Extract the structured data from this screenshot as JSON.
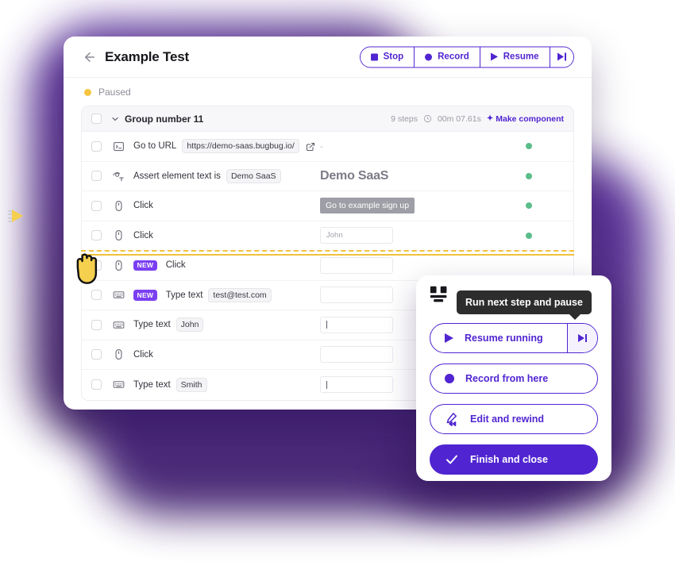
{
  "brand": {
    "purple": "#5025d1",
    "badge_purple": "#7b3ff2",
    "yellow": "#f0c23c",
    "green": "#5bbd8a",
    "tooltip_bg": "#2d2d2d"
  },
  "header": {
    "back_icon": "arrow-left-icon",
    "title": "Example Test"
  },
  "toolbar": {
    "stop_label": "Stop",
    "record_label": "Record",
    "resume_label": "Resume",
    "step_label": ""
  },
  "status": {
    "text": "Paused",
    "dot_color": "#f5c542"
  },
  "group": {
    "title": "Group number 11",
    "steps_count": "9 steps",
    "duration": "00m 07.61s",
    "make_component": "Make component",
    "spark": "✦"
  },
  "steps": [
    {
      "icon": "terminal-icon",
      "label": "Go to URL",
      "chip": "https://demo-saas.bugbug.io/",
      "external_link": true,
      "badge": "",
      "preview_type": "dash",
      "preview_text": "-",
      "status": "pass"
    },
    {
      "icon": "assert-text-icon",
      "label": "Assert element text is",
      "chip": "Demo SaaS",
      "external_link": false,
      "badge": "",
      "preview_type": "heading",
      "preview_text": "Demo SaaS",
      "status": "pass"
    },
    {
      "icon": "mouse-icon",
      "label": "Click",
      "chip": "",
      "external_link": false,
      "badge": "",
      "preview_type": "button",
      "preview_text": "Go to example sign up",
      "status": "pass"
    },
    {
      "icon": "mouse-icon",
      "label": "Click",
      "chip": "",
      "external_link": false,
      "badge": "",
      "preview_type": "input",
      "preview_text": "John",
      "status": "pass"
    },
    {
      "icon": "mouse-icon",
      "label": "Click",
      "chip": "",
      "external_link": false,
      "badge": "NEW",
      "preview_type": "input-empty",
      "preview_text": "",
      "status": "none"
    },
    {
      "icon": "keyboard-icon",
      "label": "Type text",
      "chip": "test@test.com",
      "external_link": false,
      "badge": "NEW",
      "preview_type": "input-empty",
      "preview_text": "",
      "status": "none"
    },
    {
      "icon": "keyboard-icon",
      "label": "Type text",
      "chip": "John",
      "external_link": false,
      "badge": "",
      "preview_type": "input-caret",
      "preview_text": "",
      "status": "none"
    },
    {
      "icon": "mouse-icon",
      "label": "Click",
      "chip": "",
      "external_link": false,
      "badge": "",
      "preview_type": "input-empty",
      "preview_text": "",
      "status": "none"
    },
    {
      "icon": "keyboard-icon",
      "label": "Type text",
      "chip": "Smith",
      "external_link": false,
      "badge": "",
      "preview_type": "input-caret",
      "preview_text": "",
      "status": "none"
    }
  ],
  "popup": {
    "logo_icon": "bugbug-logo-icon",
    "tooltip": "Run next step and pause",
    "buttons": [
      {
        "label": "Resume running",
        "icon": "play-icon",
        "has_step": true,
        "filled": false
      },
      {
        "label": "Record from here",
        "icon": "record-icon",
        "has_step": false,
        "filled": false
      },
      {
        "label": "Edit and rewind",
        "icon": "edit-rewind-icon",
        "has_step": false,
        "filled": false
      },
      {
        "label": "Finish and close",
        "icon": "check-icon",
        "has_step": false,
        "filled": true
      }
    ]
  },
  "cursor": {
    "icon": "hand-pointer-cursor"
  },
  "drag": {
    "icon": "drag-handle-icon"
  }
}
